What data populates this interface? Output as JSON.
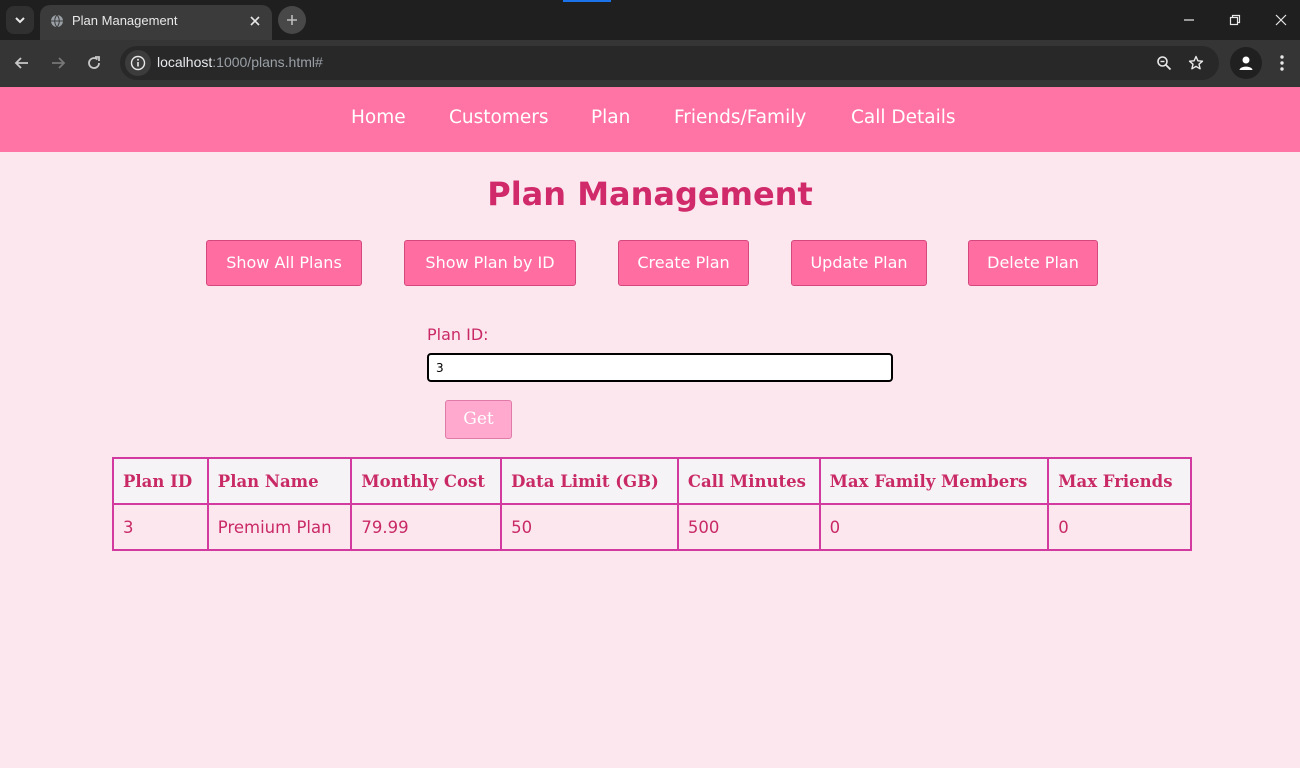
{
  "browser": {
    "tab_title": "Plan Management",
    "url_host": "localhost",
    "url_rest": ":1000/plans.html#"
  },
  "nav": {
    "items": [
      "Home",
      "Customers",
      "Plan",
      "Friends/Family",
      "Call Details"
    ]
  },
  "page": {
    "title": "Plan Management",
    "actions": [
      "Show All Plans",
      "Show Plan by ID",
      "Create Plan",
      "Update Plan",
      "Delete Plan"
    ],
    "plan_id_label": "Plan ID:",
    "plan_id_value": "3",
    "get_label": "Get"
  },
  "table": {
    "headers": [
      "Plan ID",
      "Plan Name",
      "Monthly Cost",
      "Data Limit (GB)",
      "Call Minutes",
      "Max Family Members",
      "Max Friends"
    ],
    "rows": [
      [
        "3",
        "Premium Plan",
        "79.99",
        "50",
        "500",
        "0",
        "0"
      ]
    ]
  },
  "colors": {
    "nav_bg": "#ff74a4",
    "page_bg": "#fde7ef",
    "accent_text": "#c92a66",
    "button_bg": "#ff6da1",
    "table_border": "#d23aa0"
  }
}
